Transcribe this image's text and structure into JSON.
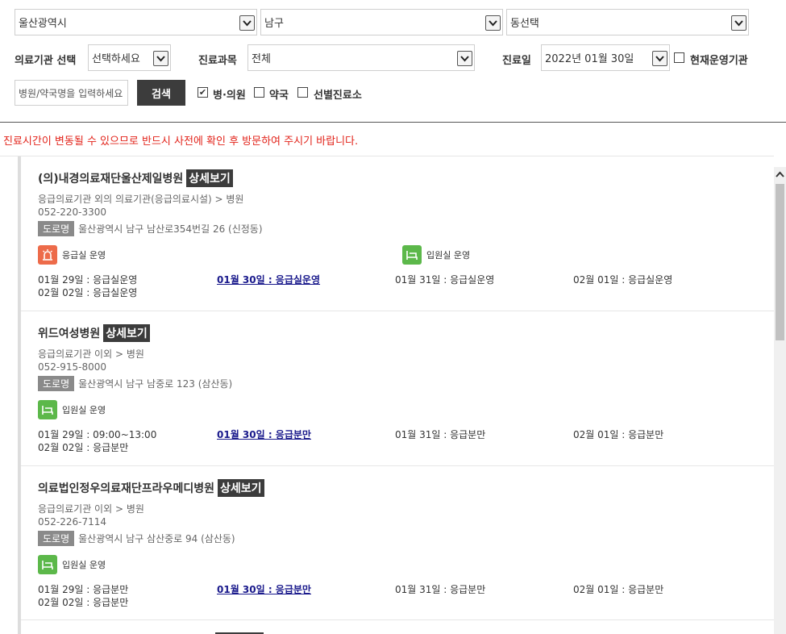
{
  "filters": {
    "city": "울산광역시",
    "district": "남구",
    "dong": "동선택",
    "institution_label": "의료기관 선택",
    "institution_value": "선택하세요",
    "department_label": "진료과목",
    "department_value": "전체",
    "date_label": "진료일",
    "date_value": "2022년 01월 30일",
    "currently_open_label": "현재운영기관",
    "currently_open_checked": false,
    "search_placeholder": "병원/약국명을 입력하세요",
    "search_button": "검색",
    "types": [
      {
        "label": "병·의원",
        "checked": true
      },
      {
        "label": "약국",
        "checked": false
      },
      {
        "label": "선별진료소",
        "checked": false
      }
    ]
  },
  "notice": "진료시간이 변동될 수 있으므로 반드시 사전에 확인 후 방문하여 주시기 바랍니다.",
  "detail_label": "상세보기",
  "road_tag": "도로명",
  "colors": {
    "er": "#ed6b4a",
    "ward": "#5cb84a",
    "today_link": "#1a1a8c",
    "notice": "#e2231a"
  },
  "hospitals": [
    {
      "name": "(의)내경의료재단울산제일병원",
      "category": "응급의료기관 외의 의료기관(응급의료시설) > 병원",
      "phone": "052-220-3300",
      "address": "울산광역시 남구 남산로354번길 26 (신정동)",
      "badges": [
        {
          "icon": "siren-icon",
          "label": "응급실 운영"
        },
        {
          "icon": "bed-icon",
          "label": "입원실 운영"
        }
      ],
      "days": [
        "01월 29일 : 응급실운영",
        "01월 30일 : 응급실운영",
        "01월 31일 : 응급실운영",
        "02월 01일 : 응급실운영",
        "02월 02일 : 응급실운영"
      ]
    },
    {
      "name": "위드여성병원",
      "category": "응급의료기관 이외 > 병원",
      "phone": "052-915-8000",
      "address": "울산광역시 남구 남중로 123 (삼산동)",
      "badges": [
        {
          "icon": "bed-icon",
          "label": "입원실 운영"
        }
      ],
      "days": [
        "01월 29일 : 09:00~13:00",
        "01월 30일 : 응급분만",
        "01월 31일 : 응급분만",
        "02월 01일 : 응급분만",
        "02월 02일 : 응급분만"
      ]
    },
    {
      "name": "의료법인정우의료재단프라우메디병원",
      "category": "응급의료기관 이외 > 병원",
      "phone": "052-226-7114",
      "address": "울산광역시 남구 삼산중로 94 (삼산동)",
      "badges": [
        {
          "icon": "bed-icon",
          "label": "입원실 운영"
        }
      ],
      "days": [
        "01월 29일 : 응급분만",
        "01월 30일 : 응급분만",
        "01월 31일 : 응급분만",
        "02월 01일 : 응급분만",
        "02월 02일 : 응급분만"
      ]
    }
  ]
}
